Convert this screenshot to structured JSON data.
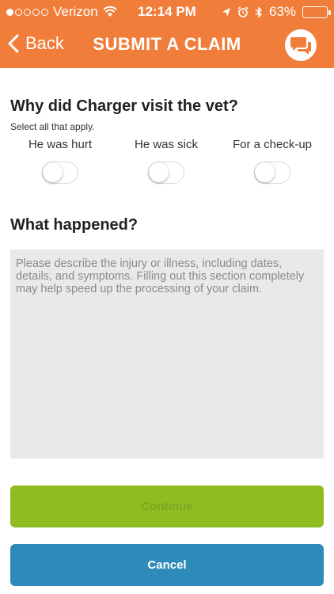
{
  "status_bar": {
    "carrier": "Verizon",
    "time": "12:14 PM",
    "battery": "63%",
    "battery_level": 0.63
  },
  "nav": {
    "back_label": "Back",
    "title": "SUBMIT A CLAIM",
    "chat_icon": "chat-bubbles-icon"
  },
  "visit": {
    "question": "Why did Charger visit the vet?",
    "hint": "Select all that apply.",
    "options": [
      {
        "label": "He was hurt",
        "on": false
      },
      {
        "label": "He was sick",
        "on": false
      },
      {
        "label": "For a check-up",
        "on": false
      }
    ]
  },
  "details": {
    "question": "What happened?",
    "placeholder": "Please describe the injury or illness, including dates, details, and symptoms. Filling out this section completely may help speed up the processing of your claim.",
    "value": ""
  },
  "actions": {
    "continue_label": "Continue",
    "cancel_label": "Cancel"
  },
  "colors": {
    "header": "#f07d3a",
    "continue": "#8fbd21",
    "cancel": "#2e8ab8",
    "textarea_bg": "#e9e9e9"
  }
}
